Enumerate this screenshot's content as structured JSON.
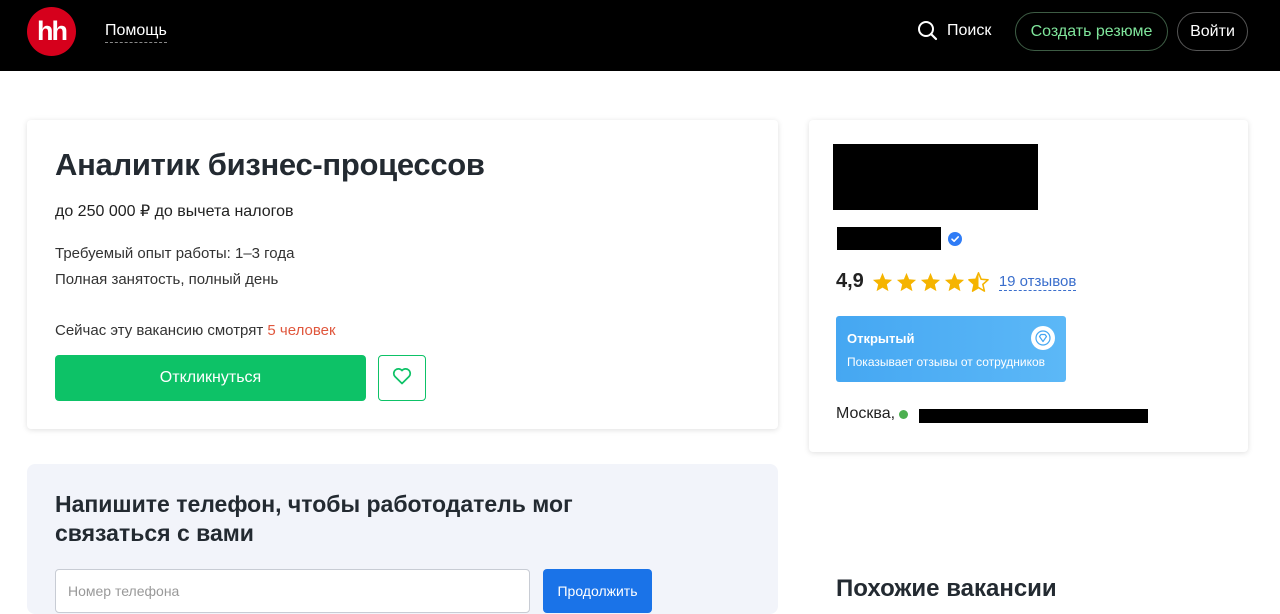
{
  "header": {
    "logo_text": "hh",
    "help_label": "Помощь",
    "search_label": "Поиск",
    "create_resume_label": "Создать резюме",
    "login_label": "Войти"
  },
  "vacancy": {
    "title": "Аналитик бизнес-процессов",
    "salary": "до 250 000 ₽ до вычета налогов",
    "experience": "Требуемый опыт работы: 1–3 года",
    "employment": "Полная занятость, полный день",
    "viewers_prefix": "Сейчас эту вакансию смотрят ",
    "viewers_count": "5 человек",
    "apply_label": "Откликнуться"
  },
  "phone_block": {
    "title": "Напишите телефон, чтобы работодатель мог связаться с вами",
    "input_placeholder": "Номер телефона",
    "continue_label": "Продолжить"
  },
  "company": {
    "rating": "4,9",
    "stars": 4.5,
    "reviews_label": "19 отзывов",
    "badge_title": "Открытый",
    "badge_subtitle": "Показывает отзывы от сотрудников",
    "city": "Москва,"
  },
  "similar": {
    "title": "Похожие вакансии"
  },
  "colors": {
    "header_bg": "#000000",
    "brand_red": "#d6001c",
    "apply_green": "#0dc267",
    "resume_text_green": "#7fe59b",
    "continue_blue": "#1a73e8",
    "viewers_red": "#e0573d",
    "star_yellow": "#f5b400",
    "badge_blue": "#45a7f2",
    "metro_green": "#4caf50"
  }
}
